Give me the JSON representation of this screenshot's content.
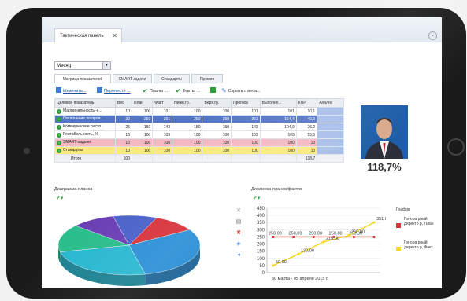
{
  "window": {
    "tab_title": "Тактическая панель",
    "close_glyph": "✕"
  },
  "period": {
    "value": "Месяц"
  },
  "subtabs": [
    "Матрица показателей",
    "SMART-задачи",
    "Стандарты",
    "Премия"
  ],
  "toolbar": {
    "change": "Изменить...",
    "transfer": "Перенести ...",
    "plans": "Планы ...",
    "facts": "Факты ...",
    "hide_weights": "Скрыть с веса..."
  },
  "table": {
    "headers": [
      "Целевой показатель",
      "Вес",
      "План",
      "Факт",
      "Нижн.гр.",
      "Верх.гр.",
      "Прогноз",
      "Выполне...",
      "КПР",
      "Анализ"
    ],
    "rows": [
      {
        "name": "Маржинальность -к...",
        "cells": [
          "10",
          "100",
          "101",
          "100",
          "100",
          "101",
          "101",
          "10,1",
          ""
        ]
      },
      {
        "name": "Отклонение по прои...",
        "cells": [
          "30",
          "250",
          "351",
          "250",
          "250",
          "351",
          "154,4",
          "46,9",
          ""
        ]
      },
      {
        "name": "Коммерческие расхо...",
        "cells": [
          "25",
          "150",
          "143",
          "150",
          "150",
          "143",
          "104,9",
          "26,2",
          ""
        ]
      },
      {
        "name": "Рентабельность, %",
        "cells": [
          "15",
          "100",
          "103",
          "100",
          "100",
          "103",
          "103",
          "15,5",
          ""
        ]
      },
      {
        "name": "SMART-задачи",
        "cells": [
          "10",
          "100",
          "100",
          "100",
          "100",
          "100",
          "100",
          "10",
          ""
        ]
      },
      {
        "name": "Стандарты",
        "cells": [
          "10",
          "100",
          "100",
          "100",
          "100",
          "100",
          "100",
          "10",
          ""
        ]
      }
    ],
    "total": {
      "label": "Итого",
      "weight": "100",
      "kpr": "118,7"
    }
  },
  "kpi_value": "118,7%",
  "pie_title": "Диаграмма планов",
  "line_title": "Динамика планов/фактов",
  "legend": {
    "title": "График",
    "plan": "Гонора рный директо р, План",
    "fact": "Гонора рный директо р, Факт"
  },
  "colors": {
    "plan": "#d8323a",
    "fact": "#f5d81a",
    "accent": "#5474c6"
  },
  "chart_data": [
    {
      "type": "pie",
      "title": "Диаграмма планов",
      "slices": [
        {
          "value": 10,
          "color": "#d8323a"
        },
        {
          "value": 30,
          "color": "#2b8fd6"
        },
        {
          "value": 25,
          "color": "#29b8d0"
        },
        {
          "value": 15,
          "color": "#2bbd8c"
        },
        {
          "value": 10,
          "color": "#6a3fb5"
        },
        {
          "value": 10,
          "color": "#4a62c9"
        }
      ]
    },
    {
      "type": "line",
      "title": "Динамика планов/фактов",
      "xlabel": "30 марта - 05 апреля 2015 г.",
      "ylim": [
        0,
        450
      ],
      "yticks": [
        "450",
        "400",
        "350",
        "300",
        "250",
        "200",
        "150",
        "100",
        "50",
        "0"
      ],
      "series": [
        {
          "name": "Гонора рный директо р, План",
          "color": "#d8323a",
          "values": [
            250,
            250,
            250,
            250,
            250,
            250
          ],
          "labels": [
            "250,00",
            "250,00",
            "250,00",
            "250,00",
            "250,00",
            ""
          ]
        },
        {
          "name": "Гонора рный директо р, Факт",
          "color": "#f5d81a",
          "values": [
            50,
            130,
            215,
            260,
            351
          ],
          "labels": [
            "50,00",
            "130,00",
            "215,00",
            "260,00",
            "351,00"
          ]
        }
      ]
    }
  ]
}
